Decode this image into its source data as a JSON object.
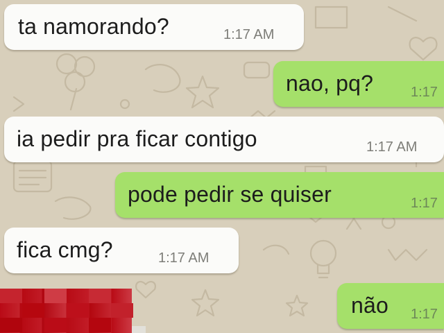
{
  "conversation": {
    "messages": [
      {
        "direction": "incoming",
        "text": "ta namorando?",
        "time": "1:17 AM"
      },
      {
        "direction": "outgoing",
        "text": "nao, pq?",
        "time": "1:17"
      },
      {
        "direction": "incoming",
        "text": "ia pedir pra ficar contigo",
        "time": "1:17 AM"
      },
      {
        "direction": "outgoing",
        "text": "pode pedir se quiser",
        "time": "1:17"
      },
      {
        "direction": "incoming",
        "text": "fica cmg?",
        "time": "1:17 AM"
      },
      {
        "direction": "outgoing",
        "text": "não",
        "time": "1:17"
      }
    ]
  },
  "colors": {
    "incoming_bubble": "#fbfbf9",
    "outgoing_bubble": "#a5e06a",
    "wallpaper": "#d9d0bd",
    "censor_block": "#b90a16"
  },
  "icons": [
    "heart-doodle-icon",
    "star-doodle-icon",
    "bulb-doodle-icon",
    "clover-doodle-icon"
  ]
}
